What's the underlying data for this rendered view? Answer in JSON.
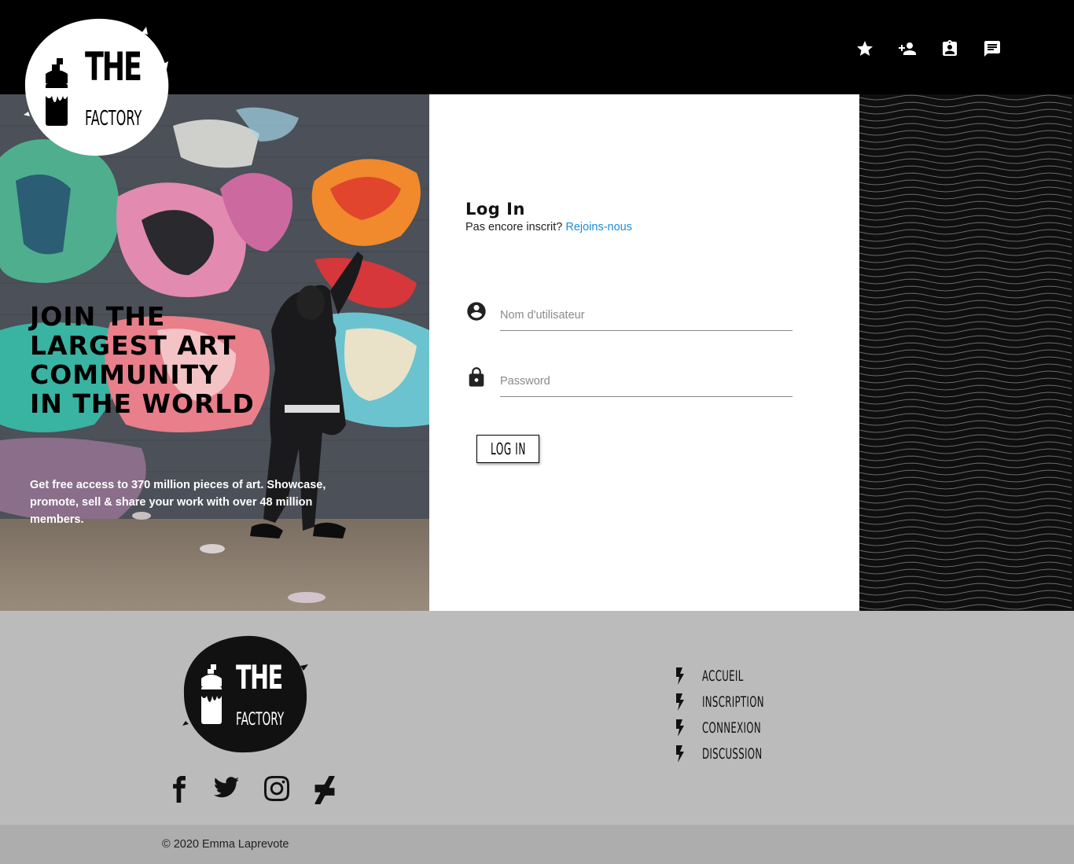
{
  "header": {
    "nav_icons": [
      "star-icon",
      "person-add-icon",
      "assignment-ind-icon",
      "chat-icon"
    ]
  },
  "logo": {
    "top": "THE",
    "bottom": "FACTORY"
  },
  "hero": {
    "heading": "JOIN THE LARGEST ART COMMUNITY IN THE WORLD",
    "subtitle": "Get free access to 370 million pieces of art. Showcase, promote, sell & share your work with over 48 million members."
  },
  "login": {
    "title": "Log In",
    "prompt": "Pas encore inscrit?",
    "join_link": "Rejoins-nous",
    "username_placeholder": "Nom d'utilisateur",
    "password_placeholder": "Password",
    "button_label": "LOG IN"
  },
  "footer": {
    "social": [
      "facebook-icon",
      "twitter-icon",
      "instagram-icon",
      "deviantart-icon"
    ],
    "nav": [
      {
        "label": "ACCUEIL"
      },
      {
        "label": "INSCRIPTION"
      },
      {
        "label": "CONNEXION"
      },
      {
        "label": "DISCUSSION"
      }
    ],
    "copyright": "© 2020 Emma Laprevote"
  },
  "colors": {
    "header_bg": "#000000",
    "footer_bg": "#bbbbbb",
    "link": "#1d8cd8",
    "wave_bg": "#0f0f0f"
  }
}
